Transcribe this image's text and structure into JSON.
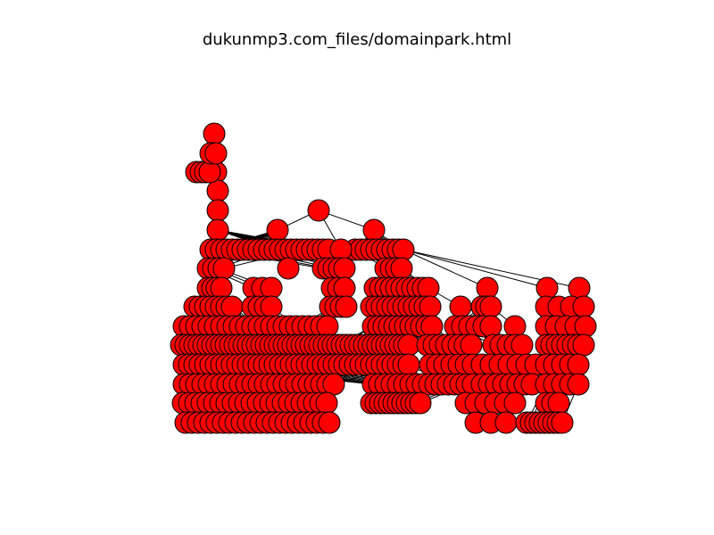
{
  "figure": {
    "title": "dukunmp3.com_files/domainpark.html"
  },
  "style": {
    "node_fill": "#ff0000",
    "node_stroke": "#000000",
    "edge_color": "#000000",
    "background": "#ffffff"
  }
}
